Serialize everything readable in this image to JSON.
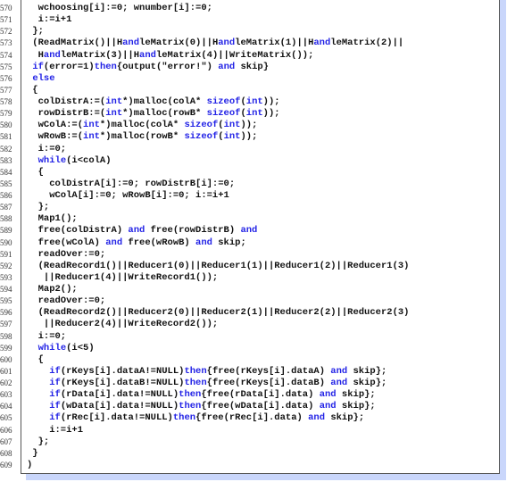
{
  "colors": {
    "keyword": "#2323e6",
    "text": "#111111",
    "shadow": "#c9d6fb"
  },
  "keywords": [
    "while",
    "if",
    "then",
    "else",
    "and",
    "int",
    "sizeof"
  ],
  "lines": [
    {
      "n": "570",
      "indent": 2,
      "text": "  wchoosing[i]:=0; wnumber[i]:=0;"
    },
    {
      "n": "571",
      "indent": 2,
      "text": "  i:=i+1"
    },
    {
      "n": "572",
      "indent": 1,
      "text": " };"
    },
    {
      "n": "573",
      "indent": 1,
      "text": " (ReadMatrix()||HandleMatrix(0)||HandleMatrix(1)||HandleMatrix(2)||"
    },
    {
      "n": "574",
      "indent": 1,
      "text": "  HandleMatrix(3)||HandleMatrix(4)||WriteMatrix());"
    },
    {
      "n": "575",
      "indent": 1,
      "text": " if(error=1)then{output(\"error!\") and skip}"
    },
    {
      "n": "576",
      "indent": 1,
      "text": " else"
    },
    {
      "n": "577",
      "indent": 1,
      "text": " {"
    },
    {
      "n": "578",
      "indent": 2,
      "text": "  colDistrA:=(int*)malloc(colA* sizeof(int));"
    },
    {
      "n": "579",
      "indent": 2,
      "text": "  rowDistrB:=(int*)malloc(rowB* sizeof(int));"
    },
    {
      "n": "580",
      "indent": 2,
      "text": "  wColA:=(int*)malloc(colA* sizeof(int));"
    },
    {
      "n": "581",
      "indent": 2,
      "text": "  wRowB:=(int*)malloc(rowB* sizeof(int));"
    },
    {
      "n": "582",
      "indent": 2,
      "text": "  i:=0;"
    },
    {
      "n": "583",
      "indent": 2,
      "text": "  while(i<colA)"
    },
    {
      "n": "584",
      "indent": 2,
      "text": "  {"
    },
    {
      "n": "585",
      "indent": 3,
      "text": "    colDistrA[i]:=0; rowDistrB[i]:=0;"
    },
    {
      "n": "586",
      "indent": 3,
      "text": "    wColA[i]:=0; wRowB[i]:=0; i:=i+1"
    },
    {
      "n": "587",
      "indent": 2,
      "text": "  };"
    },
    {
      "n": "588",
      "indent": 2,
      "text": "  Map1();"
    },
    {
      "n": "589",
      "indent": 2,
      "text": "  free(colDistrA) and free(rowDistrB) and"
    },
    {
      "n": "590",
      "indent": 2,
      "text": "  free(wColA) and free(wRowB) and skip;"
    },
    {
      "n": "591",
      "indent": 2,
      "text": "  readOver:=0;"
    },
    {
      "n": "592",
      "indent": 2,
      "text": "  (ReadRecord1()||Reducer1(0)||Reducer1(1)||Reducer1(2)||Reducer1(3)"
    },
    {
      "n": "593",
      "indent": 2,
      "text": "   ||Reducer1(4)||WriteRecord1());"
    },
    {
      "n": "594",
      "indent": 2,
      "text": "  Map2();"
    },
    {
      "n": "595",
      "indent": 2,
      "text": "  readOver:=0;"
    },
    {
      "n": "596",
      "indent": 2,
      "text": "  (ReadRecord2()||Reducer2(0)||Reducer2(1)||Reducer2(2)||Reducer2(3)"
    },
    {
      "n": "597",
      "indent": 2,
      "text": "   ||Reducer2(4)||WriteRecord2());"
    },
    {
      "n": "598",
      "indent": 2,
      "text": "  i:=0;"
    },
    {
      "n": "599",
      "indent": 2,
      "text": "  while(i<5)"
    },
    {
      "n": "600",
      "indent": 2,
      "text": "  {"
    },
    {
      "n": "601",
      "indent": 3,
      "text": "    if(rKeys[i].dataA!=NULL)then{free(rKeys[i].dataA) and skip};"
    },
    {
      "n": "602",
      "indent": 3,
      "text": "    if(rKeys[i].dataB!=NULL)then{free(rKeys[i].dataB) and skip};"
    },
    {
      "n": "603",
      "indent": 3,
      "text": "    if(rData[i].data!=NULL)then{free(rData[i].data) and skip};"
    },
    {
      "n": "604",
      "indent": 3,
      "text": "    if(wData[i].data!=NULL)then{free(wData[i].data) and skip};"
    },
    {
      "n": "605",
      "indent": 3,
      "text": "    if(rRec[i].data!=NULL)then{free(rRec[i].data) and skip};"
    },
    {
      "n": "606",
      "indent": 3,
      "text": "    i:=i+1"
    },
    {
      "n": "607",
      "indent": 2,
      "text": "  };"
    },
    {
      "n": "608",
      "indent": 1,
      "text": " }"
    },
    {
      "n": "609",
      "indent": 0,
      "text": ")"
    }
  ]
}
